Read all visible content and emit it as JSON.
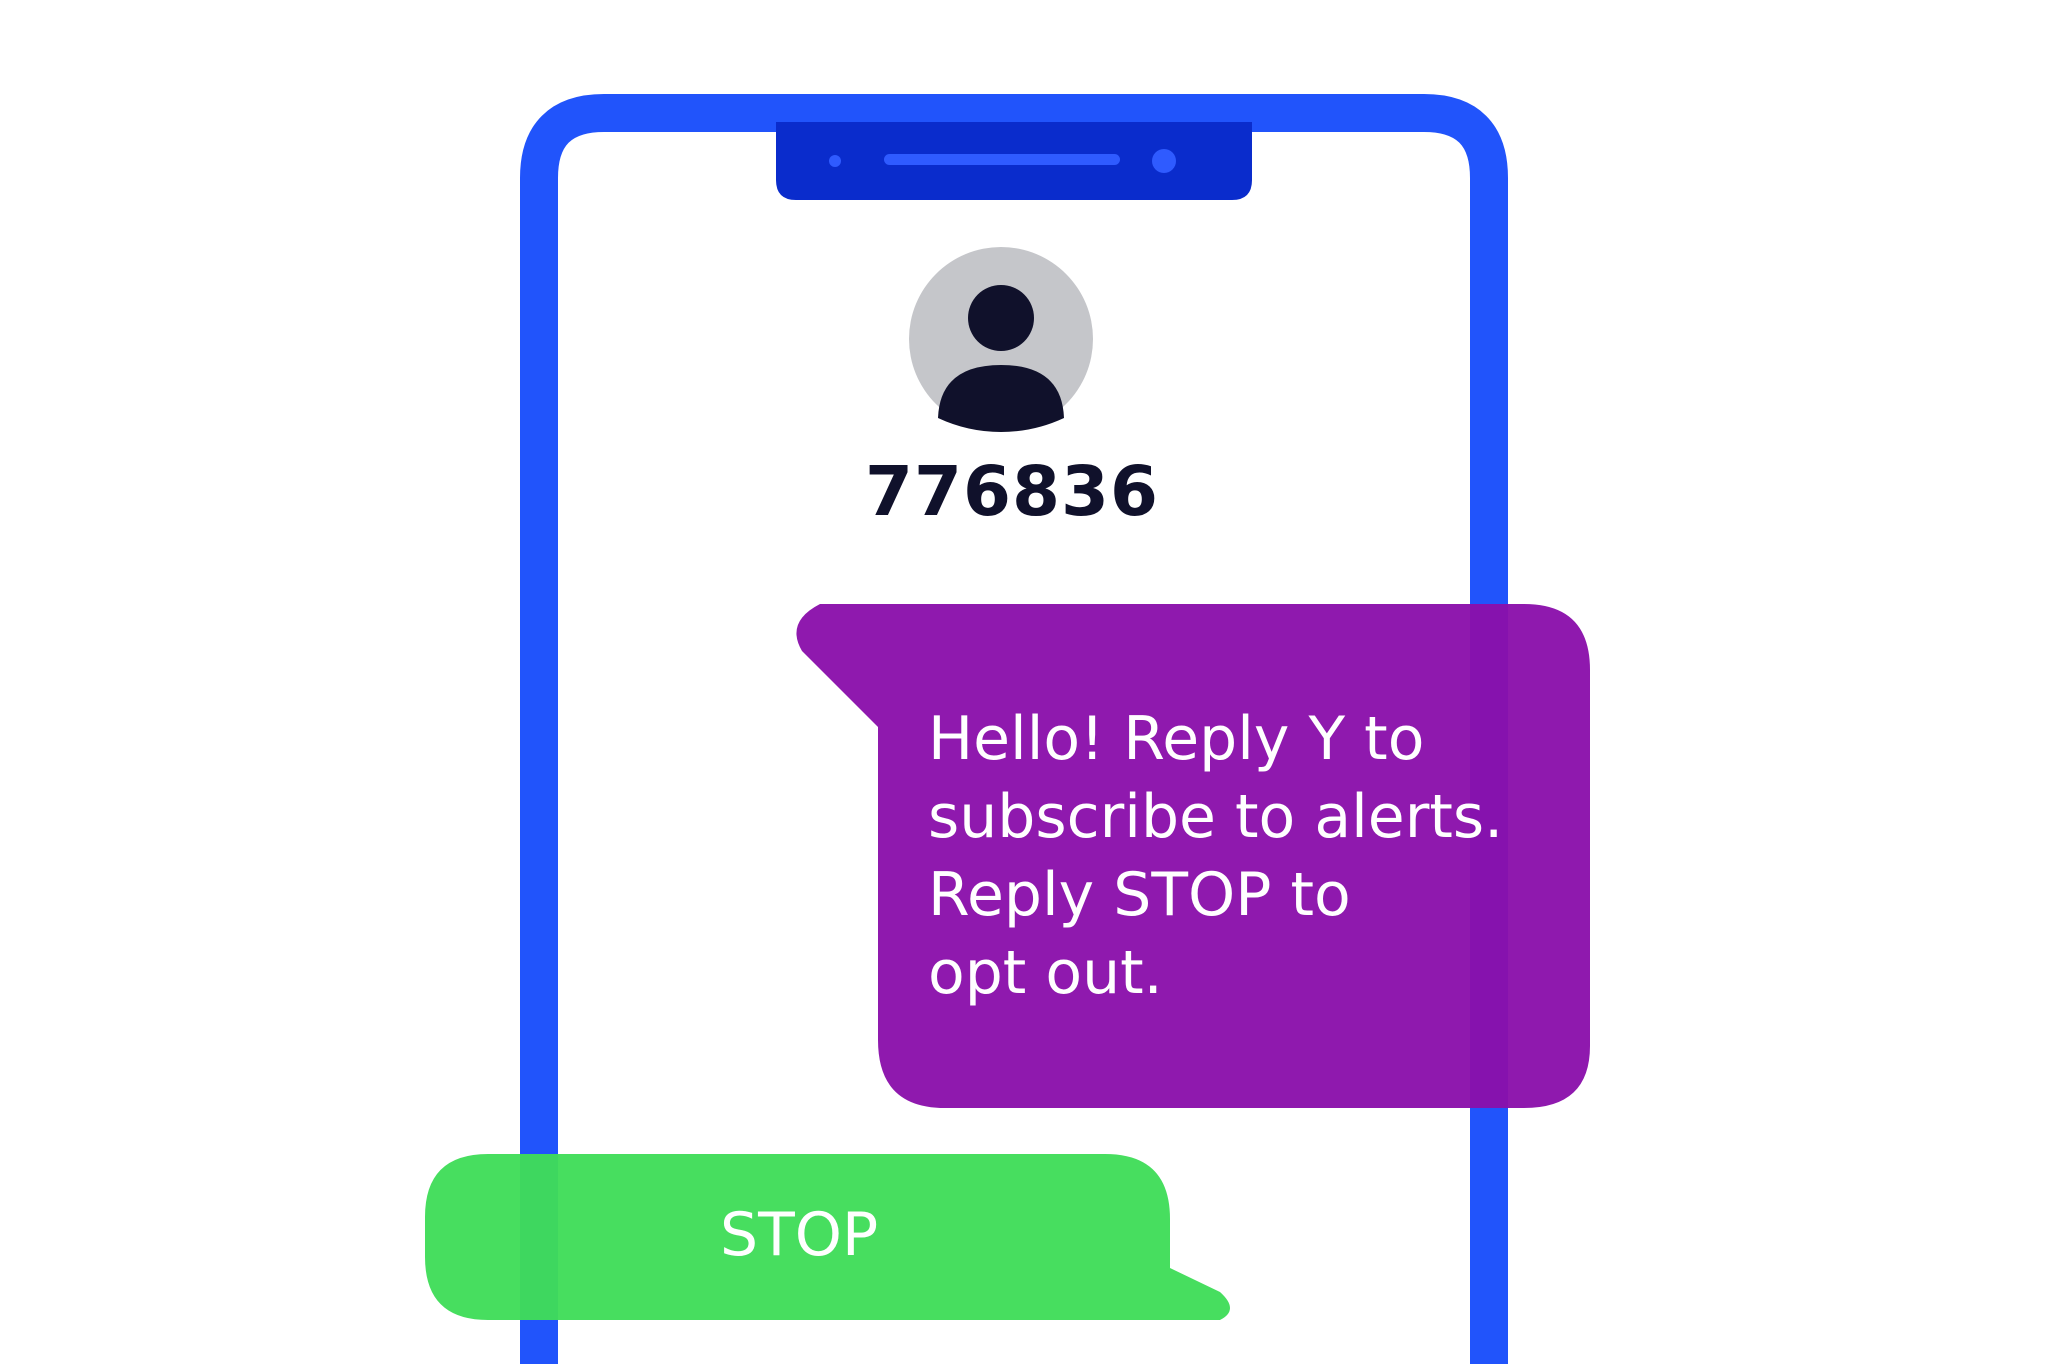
{
  "contact": {
    "name": "776836",
    "avatar_icon": "person-silhouette-icon"
  },
  "conversation": {
    "incoming_message": "Hello! Reply Y to\nsubscribe to alerts.\nReply STOP to\nopt out.",
    "outgoing_message": "STOP"
  },
  "colors": {
    "phone_frame": "#2154fb",
    "notch": "#0a2ccc",
    "incoming_bubble": "#8e12ad",
    "outgoing_bubble": "#3fdd58",
    "avatar_bg": "#c5c6ca",
    "avatar_fg": "#10112b"
  }
}
